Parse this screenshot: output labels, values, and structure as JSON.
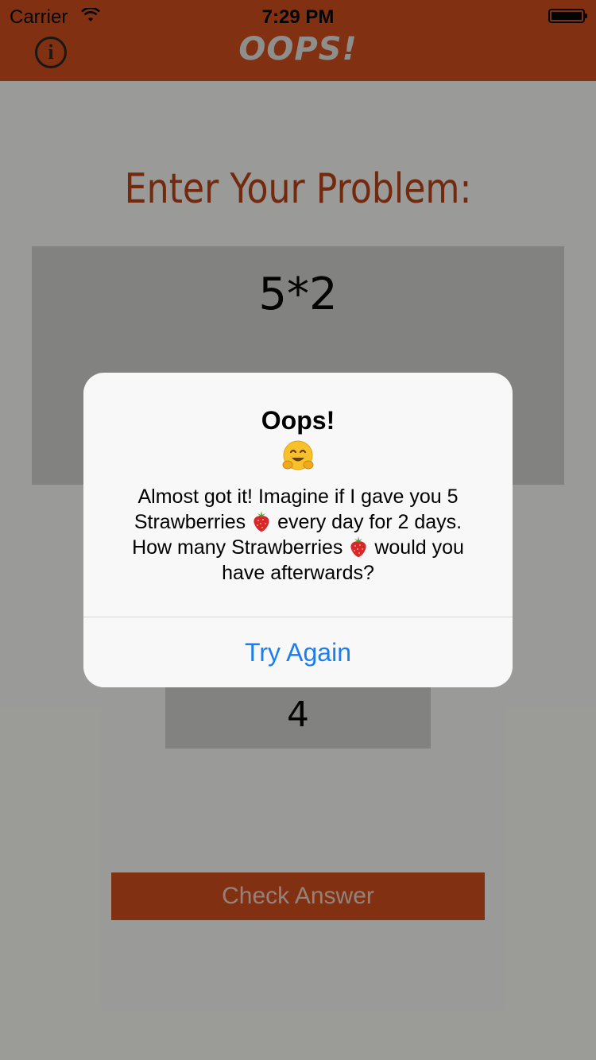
{
  "status_bar": {
    "carrier": "Carrier",
    "time": "7:29 PM"
  },
  "header": {
    "logo_text": "OOPS!",
    "info_icon": "info-icon"
  },
  "main": {
    "heading": "Enter Your Problem:",
    "problem": "5*2",
    "answer": "4",
    "check_button": "Check Answer"
  },
  "alert": {
    "title": "Oops!",
    "emoji_icon": "hugging-face-emoji",
    "message_lines": [
      {
        "before": "Almost got it! Imagine if I gave you 5",
        "after": ""
      },
      {
        "before": "Strawberries ",
        "after": " every day for 2 days."
      },
      {
        "before": "How many Strawberries ",
        "after": " would you"
      },
      {
        "before": "have afterwards?",
        "after": ""
      }
    ],
    "button": "Try Again"
  },
  "colors": {
    "brand": "#d14b1a",
    "heading": "#b73e13",
    "alert_button": "#1a7ef0"
  }
}
